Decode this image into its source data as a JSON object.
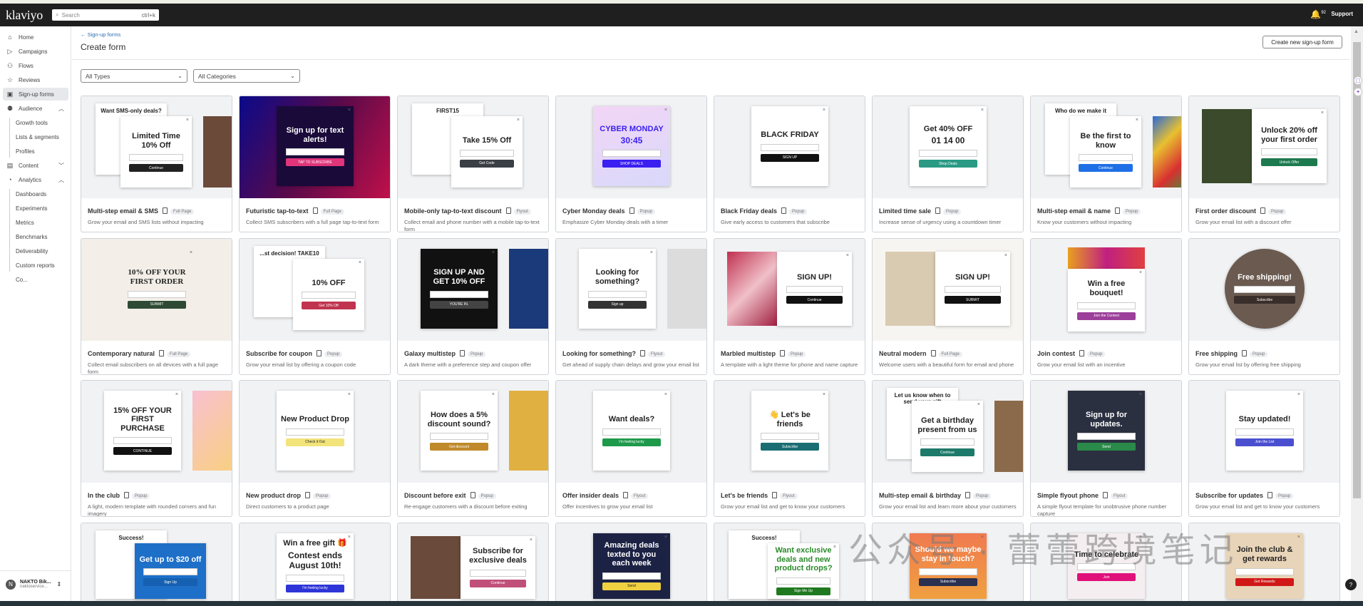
{
  "topbar": {
    "logo": "klaviyo",
    "search_placeholder": "Search",
    "search_shortcut": "ctrl+k",
    "notification_count": "92",
    "support": "Support"
  },
  "sidebar": {
    "items": [
      {
        "label": "Home",
        "icon": "home-icon",
        "glyph": "⌂"
      },
      {
        "label": "Campaigns",
        "icon": "send-icon",
        "glyph": "▷"
      },
      {
        "label": "Flows",
        "icon": "flows-icon",
        "glyph": "⚇"
      },
      {
        "label": "Reviews",
        "icon": "star-icon",
        "glyph": "☆"
      },
      {
        "label": "Sign-up forms",
        "icon": "form-icon",
        "glyph": "▣",
        "active": true
      },
      {
        "label": "Audience",
        "icon": "audience-icon",
        "glyph": "⚉",
        "chevron": "︿"
      },
      {
        "label": "Growth tools",
        "sub": true
      },
      {
        "label": "Lists & segments",
        "sub": true
      },
      {
        "label": "Profiles",
        "sub": true
      },
      {
        "label": "Content",
        "icon": "content-icon",
        "glyph": "▤",
        "chevron": "﹀"
      },
      {
        "label": "Analytics",
        "icon": "analytics-icon",
        "glyph": "◔",
        "chevron": "︿"
      },
      {
        "label": "Dashboards",
        "sub": true
      },
      {
        "label": "Experiments",
        "sub": true
      },
      {
        "label": "Metrics",
        "sub": true
      },
      {
        "label": "Benchmarks",
        "sub": true
      },
      {
        "label": "Deliverability",
        "sub": true
      },
      {
        "label": "Custom reports",
        "sub": true
      },
      {
        "label": "Co...",
        "sub": true
      }
    ],
    "account": {
      "initial": "N",
      "name": "NAKTO Bik...",
      "email": "naktoservice..."
    }
  },
  "page": {
    "breadcrumb": "← Sign-up forms",
    "title": "Create form",
    "create_button": "Create new sign-up form",
    "filter_types": "All Types",
    "filter_categories": "All Categories"
  },
  "watermark": "公众号 · 蕾蕾跨境笔记",
  "cards": [
    {
      "title": "Multi-step email & SMS",
      "type": "Full Page",
      "desc": "Grow your email and SMS lists without impacting",
      "thumb": {
        "headline": "Limited Time 10% Off",
        "button": "Continue",
        "btn": "#222222",
        "image": "#6b4a3a",
        "back": "Want SMS-only deals?"
      }
    },
    {
      "title": "Futuristic tap-to-text",
      "type": "Full Page",
      "desc": "Collect SMS subscribers with a full page tap-to-text form",
      "thumb": {
        "headline": "Sign up for text alerts!",
        "button": "TAP TO SUBSCRIBE",
        "btn": "#e0357a",
        "bg": "linear-gradient(120deg,#0a0a8a,#5a0a4a,#c0104a)",
        "pop": "#1a0a3a",
        "color": "#ffffff"
      }
    },
    {
      "title": "Mobile-only tap-to-text discount",
      "type": "Flyout",
      "desc": "Collect email and phone number with a mobile tap-to-text form",
      "thumb": {
        "headline": "Take 15% Off",
        "button": "Get Code",
        "btn": "#3a3f45",
        "back": "FIRST15"
      }
    },
    {
      "title": "Cyber Monday deals",
      "type": "Popup",
      "desc": "Emphasize Cyber Monday deals with a timer",
      "thumb": {
        "headline": "CYBER MONDAY",
        "sub": "30:45",
        "button": "SHOP DEALS",
        "btn": "#3a1ff0",
        "pop": "linear-gradient(160deg,#f3d6f5,#d8d8fb)",
        "color": "#3a1ff0"
      }
    },
    {
      "title": "Black Friday deals",
      "type": "Popup",
      "desc": "Give early access to customers that subscribe",
      "thumb": {
        "headline": "BLACK FRIDAY",
        "button": "SIGN UP",
        "btn": "#111111"
      }
    },
    {
      "title": "Limited time sale",
      "type": "Popup",
      "desc": "Increase sense of urgency using a countdown timer",
      "thumb": {
        "headline": "Get 40% OFF",
        "sub": "01 14 00",
        "button": "Shop Deals",
        "btn": "#2a9a84"
      }
    },
    {
      "title": "Multi-step email & name",
      "type": "Popup",
      "desc": "Know your customers without impacting",
      "thumb": {
        "headline": "Be the first to know",
        "button": "Continue",
        "btn": "#1f6fe6",
        "image": "linear-gradient(135deg,#2a6ad8,#e8c030,#d83030,#2aa040)",
        "back": "Who do we make it"
      }
    },
    {
      "title": "First order discount",
      "type": "Popup",
      "desc": "Grow your email list with a discount offer",
      "thumb": {
        "headline": "Unlock 20% off your first order",
        "button": "Unlock Offer",
        "btn": "#1d7a4f",
        "image": "#3a4a2a",
        "imageLeft": true
      }
    },
    {
      "title": "Contemporary natural",
      "type": "Full Page",
      "desc": "Collect email subscribers on all devices with a full page form",
      "thumb": {
        "headline": "10% OFF YOUR FIRST ORDER",
        "button": "SUBMIT",
        "btn": "#2e4a35",
        "bg": "#f3efe8",
        "pop": "transparent",
        "serif": true
      }
    },
    {
      "title": "Subscribe for coupon",
      "type": "Popup",
      "desc": "Grow your email list by offering a coupon code",
      "thumb": {
        "headline": "10% OFF",
        "button": "Get 10% Off",
        "btn": "#c0344f",
        "back": "...st decision! TAKE10"
      }
    },
    {
      "title": "Galaxy multistep",
      "type": "Popup",
      "desc": "A dark theme with a preference step and coupon offer",
      "thumb": {
        "headline": "SIGN UP AND GET 10% OFF",
        "button": "YOU'RE IN.",
        "btn": "#444444",
        "pop": "#111111",
        "color": "#ffffff",
        "image": "#1a3a7a"
      }
    },
    {
      "title": "Looking for something?",
      "type": "Flyout",
      "desc": "Get ahead of supply chain delays and grow your email list",
      "thumb": {
        "headline": "Looking for something?",
        "button": "Sign up",
        "btn": "#333333",
        "image": "#dcdcdc"
      }
    },
    {
      "title": "Marbled multistep",
      "type": "Popup",
      "desc": "A template with a light theme for phone and name capture",
      "thumb": {
        "headline": "SIGN UP!",
        "button": "Continue",
        "btn": "#111111",
        "image": "linear-gradient(135deg,#c03050,#f0c0c8,#a02040)",
        "imageLeft": true
      }
    },
    {
      "title": "Neutral modern",
      "type": "Full Page",
      "desc": "Welcome users with a beautiful form for email and phone",
      "thumb": {
        "headline": "SIGN UP!",
        "button": "SUBMIT",
        "btn": "#111111",
        "bg": "#f7f5f1",
        "image": "#d9cbb2",
        "imageLeft": true
      }
    },
    {
      "title": "Join contest",
      "type": "Popup",
      "desc": "Grow your email list with an incentive",
      "thumb": {
        "headline": "Win a free bouquet!",
        "button": "Join the Contest",
        "btn": "#9c3f9a",
        "image": "linear-gradient(90deg,#e8a020,#c02080,#e04040)",
        "imageTop": true
      }
    },
    {
      "title": "Free shipping",
      "type": "Popup",
      "desc": "Grow your email list by offering free shipping",
      "thumb": {
        "headline": "Free shipping!",
        "button": "Subscribe",
        "btn": "#3a2e2a",
        "pop": "#6b5a50",
        "color": "#ffffff",
        "circle": true
      }
    },
    {
      "title": "In the club",
      "type": "Popup",
      "desc": "A light, modern template with rounded corners and fun imagery",
      "thumb": {
        "headline": "15% OFF YOUR FIRST PURCHASE",
        "button": "CONTINUE",
        "btn": "#111111",
        "image": "linear-gradient(135deg,#f8c0d0,#f8d080)"
      }
    },
    {
      "title": "New product drop",
      "type": "Popup",
      "desc": "Direct customers to a product page",
      "thumb": {
        "headline": "New Product Drop",
        "button": "Check it Out",
        "btn": "#f2e37a",
        "btnText": "#222222"
      }
    },
    {
      "title": "Discount before exit",
      "type": "Popup",
      "desc": "Re-engage customers with a discount before exiting",
      "thumb": {
        "headline": "How does a 5% discount sound?",
        "button": "Get discount",
        "btn": "#c08a2a",
        "image": "#e0b040"
      }
    },
    {
      "title": "Offer insider deals",
      "type": "Flyout",
      "desc": "Offer incentives to grow your email list",
      "thumb": {
        "headline": "Want deals?",
        "button": "I'm feeling lucky",
        "btn": "#1e9a4a"
      }
    },
    {
      "title": "Let's be friends",
      "type": "Flyout",
      "desc": "Grow your email list and get to know your customers",
      "thumb": {
        "headline": "👋 Let's be friends",
        "button": "Subscribe",
        "btn": "#1a6e73"
      }
    },
    {
      "title": "Multi-step email & birthday",
      "type": "Popup",
      "desc": "Grow your email list and learn more about your customers",
      "thumb": {
        "headline": "Get a birthday present from us",
        "button": "Continue",
        "btn": "#1d7a6a",
        "image": "#8a6a4a",
        "back": "Let us know when to send your gift"
      }
    },
    {
      "title": "Simple flyout phone",
      "type": "Flyout",
      "desc": "A simple flyout template for unobtrusive phone number capture",
      "thumb": {
        "headline": "Sign up for updates.",
        "button": "Send",
        "btn": "#2a8a4a",
        "pop": "#2a3040",
        "color": "#ffffff"
      }
    },
    {
      "title": "Subscribe for updates",
      "type": "Popup",
      "desc": "Grow your email list and get to know your customers",
      "thumb": {
        "headline": "Stay updated!",
        "button": "Join the List",
        "btn": "#4a4fd0"
      }
    },
    {
      "thumb": {
        "headline": "Get up to $20 off",
        "button": "Sign Up",
        "btn": "#1560b0",
        "pop": "#1d6fc8",
        "color": "#ffffff",
        "back": "Success!"
      }
    },
    {
      "thumb": {
        "headline": "Win a free gift 🎁",
        "sub": "Contest ends August 10th!",
        "button": "I'm feeling lucky",
        "btn": "#2e35d8"
      }
    },
    {
      "thumb": {
        "headline": "Subscribe for exclusive deals",
        "button": "Continue",
        "btn": "#c0507a",
        "image": "#6a4a3a",
        "imageLeft": true
      }
    },
    {
      "thumb": {
        "headline": "Amazing deals texted to you each week",
        "button": "Send",
        "btn": "#f0d040",
        "btnText": "#222222",
        "pop": "#1c2244",
        "color": "#ffffff"
      }
    },
    {
      "thumb": {
        "headline": "Want exclusive deals and new product drops?",
        "button": "Sign Me Up",
        "btn": "#1f7a1f",
        "color": "#2a8a2a",
        "back": "Success!"
      }
    },
    {
      "thumb": {
        "headline": "Should we maybe stay in touch?",
        "button": "Subscribe",
        "btn": "#2a3050",
        "pop": "linear-gradient(180deg,#f07a50,#f0a040)",
        "color": "#ffffff"
      }
    },
    {
      "thumb": {
        "headline": "Time to celebrate",
        "button": "Join",
        "btn": "#e0107a",
        "pop": "#f4eef0"
      }
    },
    {
      "thumb": {
        "headline": "Join the club & get rewards",
        "button": "Get Rewards",
        "btn": "#d01818",
        "pop": "#e8d4b8"
      }
    }
  ]
}
